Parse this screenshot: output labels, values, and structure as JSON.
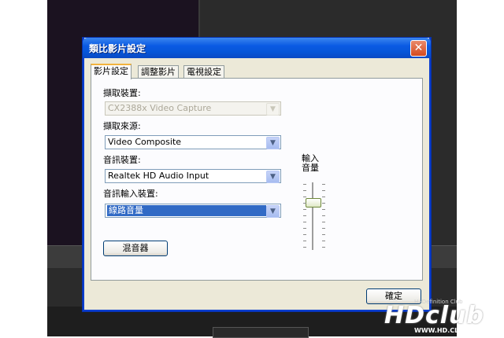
{
  "dialog": {
    "title": "類比影片設定",
    "tabs": [
      {
        "label": "影片設定",
        "active": true
      },
      {
        "label": "調整影片",
        "active": false
      },
      {
        "label": "電視設定",
        "active": false
      }
    ],
    "capture_device": {
      "label": "擷取裝置:",
      "value": "CX2388x Video Capture",
      "disabled": true
    },
    "capture_source": {
      "label": "擷取來源:",
      "value": "Video Composite"
    },
    "audio_device": {
      "label": "音訊裝置:",
      "value": "Realtek HD Audio Input"
    },
    "audio_input_device": {
      "label": "音訊輸入裝置:",
      "value": "線路音量",
      "selected": true
    },
    "mixer_button": "混音器",
    "input_volume_label_line1": "輸入",
    "input_volume_label_line2": "音量",
    "input_volume_level": 0.75,
    "ok_button": "確定"
  },
  "watermark": {
    "logo": "HDclub",
    "tagline": "Hi-Definition Club",
    "url": "WWW.HD.CLUB.TW"
  },
  "colors": {
    "titlebar": "#0a5ae3",
    "dialog_bg": "#ece9d8",
    "selection": "#316ac5",
    "close_button": "#d44a1f"
  }
}
